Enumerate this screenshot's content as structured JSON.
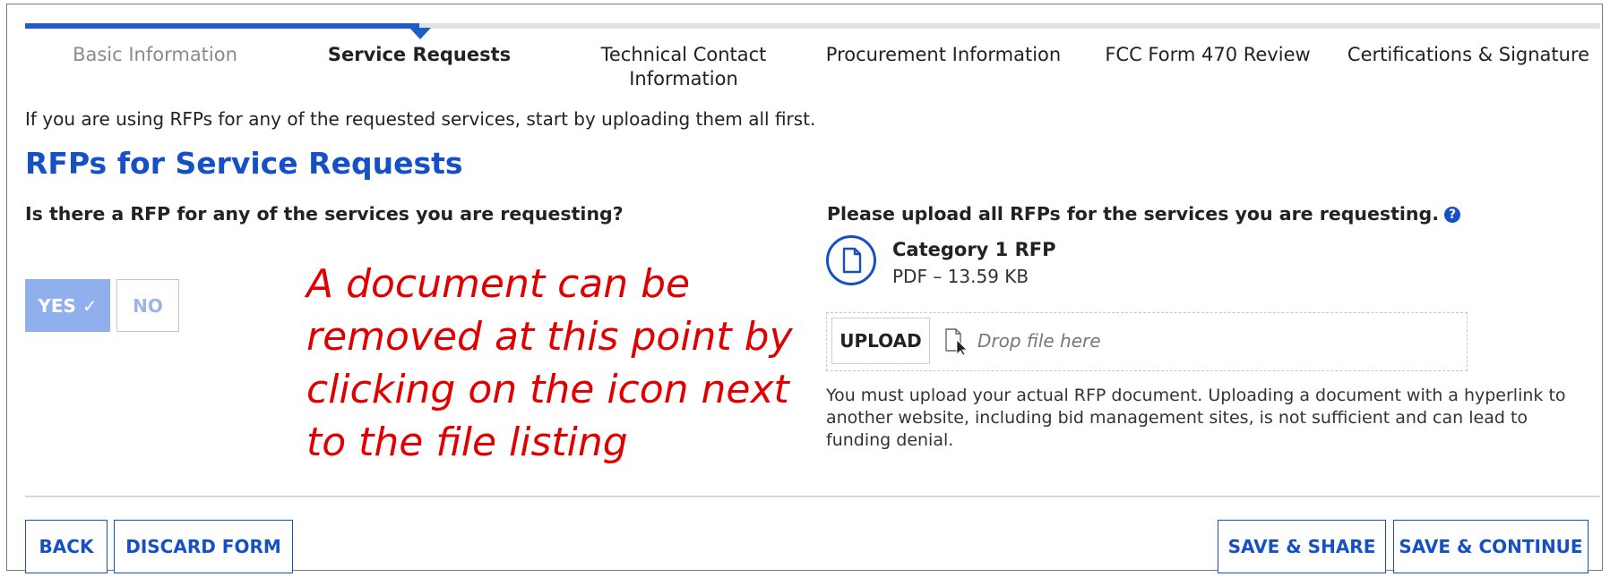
{
  "steps": [
    {
      "label": "Basic Information",
      "state": "done"
    },
    {
      "label": "Service Requests",
      "state": "active"
    },
    {
      "label": "Technical Contact Information",
      "state": "upcoming"
    },
    {
      "label": "Procurement Information",
      "state": "upcoming"
    },
    {
      "label": "FCC Form 470 Review",
      "state": "upcoming"
    },
    {
      "label": "Certifications & Signature",
      "state": "upcoming"
    }
  ],
  "intro": "If you are using RFPs for any of the requested services, start by uploading them all first.",
  "section_title": "RFPs for Service Requests",
  "question": {
    "label": "Is there a RFP for any of the services you are requesting?",
    "yes_label": "YES ✓",
    "no_label": "NO",
    "selected": "YES"
  },
  "annotation": "A document can be removed at this point by clicking on the icon next to the file listing",
  "upload": {
    "heading": "Please upload all RFPs for the services you are requesting.",
    "help_glyph": "?",
    "file_name": "Category 1 RFP",
    "file_meta": "PDF – 13.59 KB",
    "upload_label": "UPLOAD",
    "drop_placeholder": "Drop file here",
    "notice": "You must upload your actual RFP document. Uploading a document with a hyperlink to another website, including bid management sites, is not sufficient and can lead to funding denial."
  },
  "footer": {
    "back_label": "BACK",
    "discard_label": "DISCARD FORM",
    "save_share_label": "SAVE & SHARE",
    "save_continue_label": "SAVE & CONTINUE"
  },
  "colors": {
    "accent": "#1550c4",
    "annotation": "#e00000",
    "selected_button": "#8fb0ec"
  }
}
